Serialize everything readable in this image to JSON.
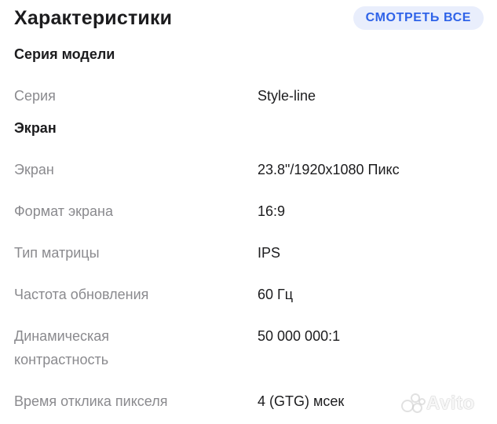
{
  "header": {
    "title": "Характеристики",
    "see_all_label": "СМОТРЕТЬ ВСЕ"
  },
  "sections": [
    {
      "title": "Серия модели",
      "rows": [
        {
          "label": "Серия",
          "value": "Style-line"
        }
      ]
    },
    {
      "title": "Экран",
      "rows": [
        {
          "label": "Экран",
          "value": "23.8\"/1920x1080 Пикс"
        },
        {
          "label": "Формат экрана",
          "value": "16:9"
        },
        {
          "label": "Тип матрицы",
          "value": "IPS"
        },
        {
          "label": "Частота обновления",
          "value": "60 Гц"
        },
        {
          "label_line1": "Динамическая",
          "label_line2": "контрастность",
          "value": "50 000 000:1"
        },
        {
          "label": "Время отклика пикселя",
          "value": "4 (GTG) мсек"
        }
      ]
    }
  ],
  "watermark": {
    "text": "Avito"
  },
  "colors": {
    "accent": "#2f63e8",
    "accent_bg": "#e9eefc",
    "label": "#8a8a8e",
    "text": "#1c1c1e"
  }
}
